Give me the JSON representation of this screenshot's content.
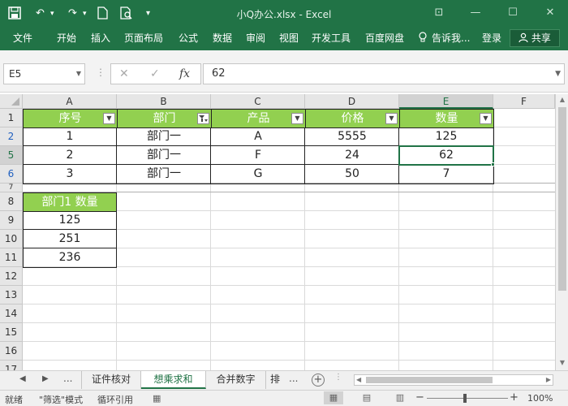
{
  "titlebar": {
    "title": "小Q办公.xlsx - Excel",
    "save_icon": "💾",
    "undo_icon": "↶",
    "redo_icon": "↷",
    "new_icon": "🗋",
    "preview_icon": "🔍",
    "customize_icon": "▾",
    "ribbon_options_icon": "⊡",
    "minimize_icon": "—",
    "restore_icon": "☐",
    "close_icon": "✕"
  },
  "ribbon": {
    "tabs": [
      "文件",
      "开始",
      "插入",
      "页面布局",
      "公式",
      "数据",
      "审阅",
      "视图",
      "开发工具",
      "百度网盘"
    ],
    "tell_me": "告诉我...",
    "login": "登录",
    "share": "共享"
  },
  "formula_bar": {
    "name_box": "E5",
    "cancel_icon": "✕",
    "enter_icon": "✓",
    "fx_label": "fx",
    "value": "62"
  },
  "grid": {
    "columns": [
      "A",
      "B",
      "C",
      "D",
      "E",
      "F"
    ],
    "rows": [
      "1",
      "2",
      "5",
      "6",
      "7",
      "8",
      "9",
      "10",
      "11",
      "12",
      "13",
      "14",
      "15",
      "16",
      "17"
    ],
    "table_headers": [
      "序号",
      "部门",
      "产品",
      "价格",
      "数量"
    ],
    "table_rows": [
      [
        "1",
        "部门一",
        "A",
        "5555",
        "125"
      ],
      [
        "2",
        "部门一",
        "F",
        "24",
        "62"
      ],
      [
        "3",
        "部门一",
        "G",
        "50",
        "7"
      ]
    ],
    "filter_icon": "▼",
    "filter_active_icon": "▼",
    "summary_header": "部门1 数量",
    "summary_values": [
      "125",
      "251",
      "236"
    ],
    "selected_cell": "E5",
    "colors": {
      "header_fill": "#92d050",
      "accent": "#217346",
      "filtered_row_number": "#1f5fbf"
    }
  },
  "sheet_tabs": {
    "nav_prev": "◀",
    "nav_next": "▶",
    "nav_more": "...",
    "tabs": [
      "证件核对",
      "想乘求和",
      "合并数字",
      "排"
    ],
    "active": "想乘求和",
    "more": "...",
    "add": "+"
  },
  "status_bar": {
    "ready": "就绪",
    "filter_mode": "\"筛选\"模式",
    "circular_ref": "循环引用",
    "zoom": "100%",
    "zoom_minus": "−",
    "zoom_plus": "+"
  }
}
